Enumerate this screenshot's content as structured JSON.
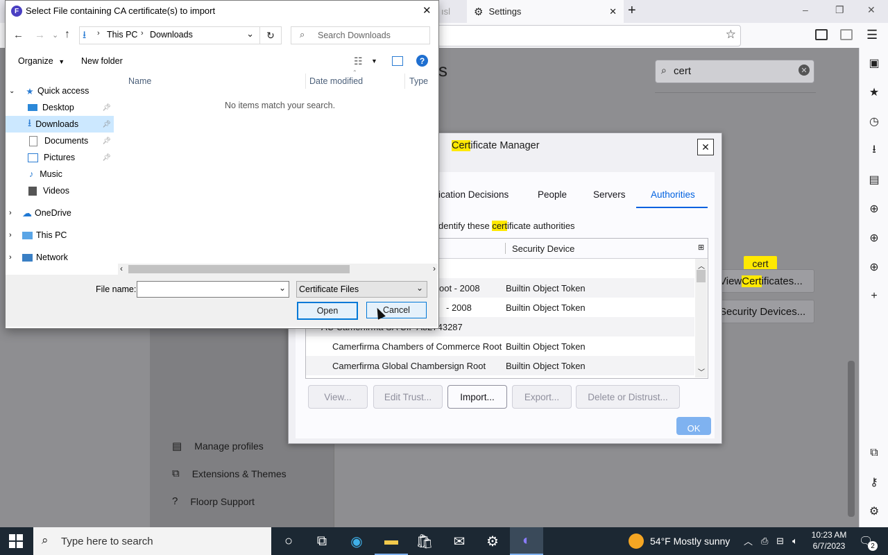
{
  "browser": {
    "tabs": [
      {
        "label": "ısl"
      },
      {
        "label": "Settings"
      }
    ],
    "new_tab": "+",
    "window_controls": {
      "minimize": "–",
      "restore": "❐",
      "close": "✕"
    }
  },
  "settings": {
    "search_value": "cert",
    "view_certificates_label": "View Certificates...",
    "security_devices_label": "Security Devices...",
    "tooltip": "cert",
    "nav_links": [
      {
        "label": "Manage profiles"
      },
      {
        "label": "Extensions & Themes"
      },
      {
        "label": "Floorp Support"
      }
    ],
    "heading_fragment": "s"
  },
  "cert_manager": {
    "title": "Certificate Manager",
    "tabs": [
      {
        "label": "ication Decisions"
      },
      {
        "label": "People"
      },
      {
        "label": "Servers"
      },
      {
        "label": "Authorities"
      }
    ],
    "description": "dentify these certificate authorities",
    "columns": {
      "device": "Security Device"
    },
    "rows": [
      {
        "name": "oot - 2008",
        "device": "Builtin Object Token"
      },
      {
        "name": "- 2008",
        "device": "Builtin Object Token"
      },
      {
        "name": "AC Camerfirma SA CIF A82743287",
        "device": ""
      },
      {
        "name": "Camerfirma Chambers of Commerce Root",
        "device": "Builtin Object Token"
      },
      {
        "name": "Camerfirma Global Chambersign Root",
        "device": "Builtin Object Token"
      }
    ],
    "buttons": {
      "view": "View...",
      "edit_trust": "Edit Trust...",
      "import": "Import...",
      "export": "Export...",
      "delete": "Delete or Distrust...",
      "ok": "OK"
    }
  },
  "file_dialog": {
    "title": "Select File containing CA certificate(s) to import",
    "breadcrumb": [
      "This PC",
      "Downloads"
    ],
    "search_placeholder": "Search Downloads",
    "organize": "Organize",
    "new_folder": "New folder",
    "columns": {
      "name": "Name",
      "date": "Date modified",
      "type": "Type"
    },
    "empty_message": "No items match your search.",
    "quick_access": "Quick access",
    "quick_items": [
      "Desktop",
      "Downloads",
      "Documents",
      "Pictures",
      "Music",
      "Videos"
    ],
    "roots": [
      "OneDrive",
      "This PC",
      "Network"
    ],
    "file_name_label": "File name:",
    "file_name_value": "",
    "file_type": "Certificate Files",
    "open": "Open",
    "cancel": "Cancel"
  },
  "taskbar": {
    "search_placeholder": "Type here to search",
    "weather": "54°F  Mostly sunny",
    "time": "10:23 AM",
    "date": "6/7/2023",
    "notification_count": "2"
  }
}
